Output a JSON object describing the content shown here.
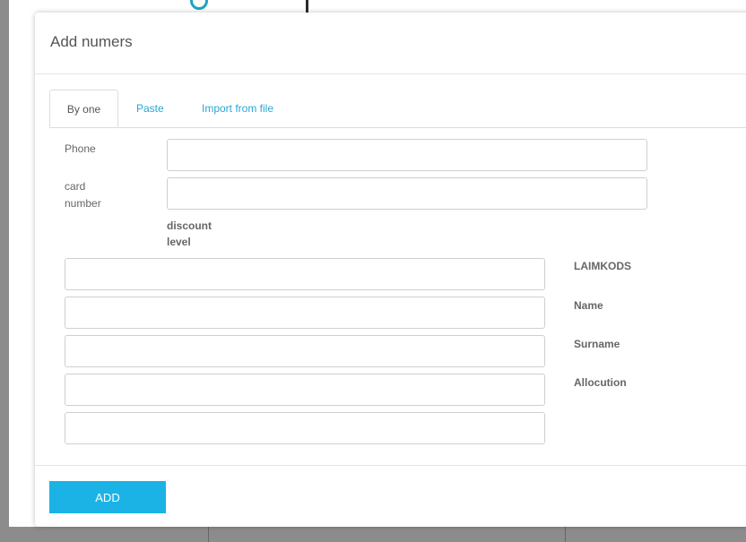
{
  "dialog": {
    "title": "Add numers"
  },
  "tabs": [
    {
      "label": "By one",
      "active": true
    },
    {
      "label": "Paste",
      "active": false
    },
    {
      "label": "Import from file",
      "active": false
    }
  ],
  "form": {
    "phone_label": "Phone",
    "phone_value": "",
    "card_label_line1": "card",
    "card_label_line2": "number",
    "card_value": "",
    "discount_label_line1": "discount",
    "discount_label_line2": "level",
    "fields": [
      {
        "label": "LAIMKODS",
        "value": ""
      },
      {
        "label": "Name",
        "value": ""
      },
      {
        "label": "Surname",
        "value": ""
      },
      {
        "label": "Allocution",
        "value": ""
      },
      {
        "label": "",
        "value": ""
      }
    ]
  },
  "footer": {
    "add_label": "ADD"
  },
  "colors": {
    "accent": "#1bb3e6",
    "tab_link": "#2aa6d6"
  }
}
